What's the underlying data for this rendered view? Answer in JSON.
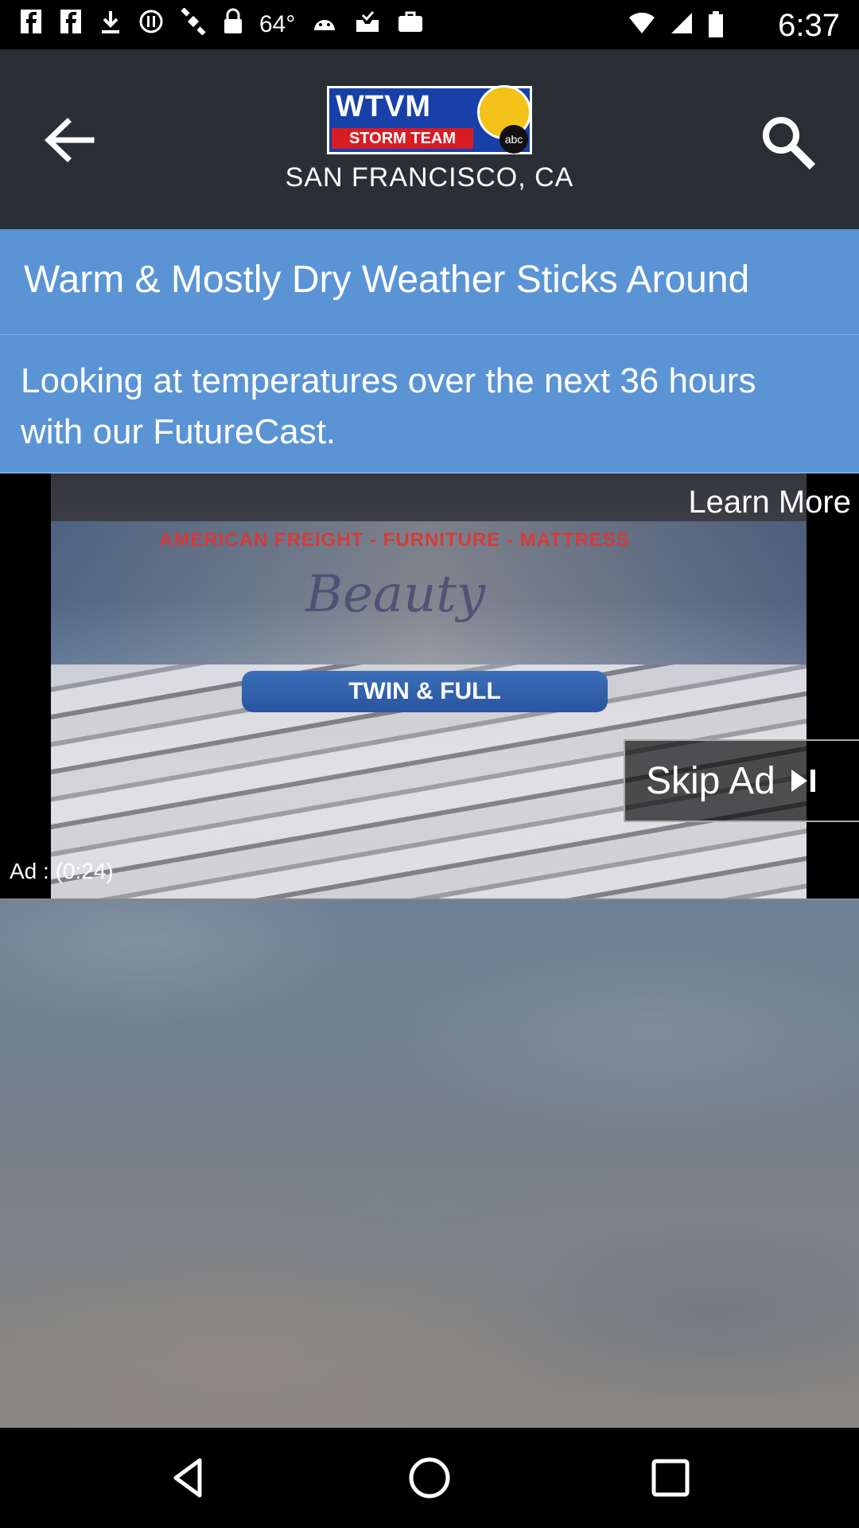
{
  "status_bar": {
    "time": "6:37",
    "temperature": "64°",
    "icons": [
      "facebook-icon",
      "facebook-icon",
      "download-icon",
      "circle-icon",
      "satellite-icon",
      "lock-icon",
      "temperature",
      "android-icon",
      "tray-icon",
      "bag-icon"
    ]
  },
  "header": {
    "logo_text": "WTVM",
    "logo_subtext": "STORM TEAM",
    "logo_badge": "abc",
    "location": "SAN FRANCISCO, CA"
  },
  "article": {
    "headline": "Warm & Mostly Dry Weather Sticks Around",
    "description": "Looking at temperatures over the next 36 hours with our FutureCast."
  },
  "video_ad": {
    "learn_more": "Learn More",
    "skip_label": "Skip Ad",
    "timer": "Ad : (0:24)",
    "brand_text": "AMERICAN FREIGHT - FURNITURE - MATTRESS",
    "script_text": "Beauty",
    "banner_text": "TWIN & FULL"
  },
  "colors": {
    "accent_blue": "#5b94d4",
    "header_bg": "#1e1e20"
  }
}
